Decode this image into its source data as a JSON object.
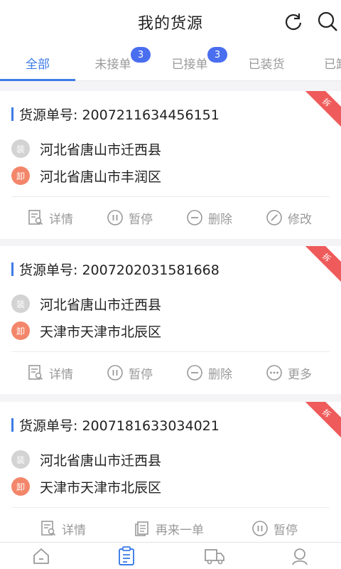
{
  "header": {
    "title": "我的货源",
    "refresh_icon": "refresh-icon",
    "search_icon": "search-icon"
  },
  "tabs": [
    {
      "label": "全部",
      "active": true
    },
    {
      "label": "未接单",
      "badge": "3"
    },
    {
      "label": "已接单",
      "badge": "3"
    },
    {
      "label": "已装货"
    },
    {
      "label": "已卸"
    }
  ],
  "cards": [
    {
      "number_label": "货源单号: 2007211634456151",
      "ribbon": "拆",
      "load_tag": "装",
      "unload_tag": "卸",
      "from": "河北省唐山市迁西县",
      "to": "河北省唐山市丰润区",
      "actions": [
        "详情",
        "暂停",
        "删除",
        "修改"
      ]
    },
    {
      "number_label": "货源单号: 2007202031581668",
      "ribbon": "拆",
      "load_tag": "装",
      "unload_tag": "卸",
      "from": "河北省唐山市迁西县",
      "to": "天津市天津市北辰区",
      "actions": [
        "详情",
        "暂停",
        "删除",
        "更多"
      ]
    },
    {
      "number_label": "货源单号: 2007181633034021",
      "ribbon": "拆",
      "load_tag": "装",
      "unload_tag": "卸",
      "from": "河北省唐山市迁西县",
      "to": "天津市天津市北辰区",
      "actions": [
        "详情",
        "再来一单",
        "暂停"
      ]
    }
  ],
  "bottom_nav": [
    "home-icon",
    "orders-icon",
    "truck-icon",
    "profile-icon"
  ],
  "colors": {
    "accent": "#3c7be6",
    "badge": "#4a6ef0",
    "ribbon": "#ef5a5a",
    "unload": "#f3866a"
  }
}
